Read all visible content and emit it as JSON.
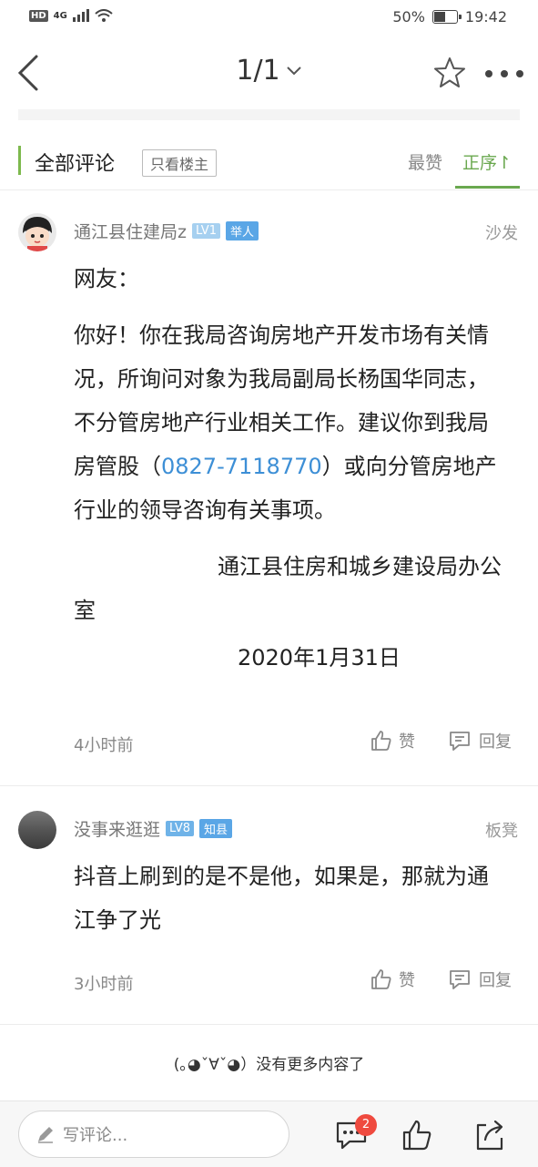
{
  "status_bar": {
    "hd": "HD",
    "network": "4G",
    "battery": "50%",
    "time": "19:42"
  },
  "nav": {
    "page_indicator": "1/1",
    "icons": [
      "back-icon",
      "chevron-down-icon",
      "star-icon",
      "more-icon"
    ]
  },
  "tabs": {
    "title": "全部评论",
    "only_op": "只看楼主",
    "sort_hot": "最赞",
    "sort_asc": "正序↾"
  },
  "comments": [
    {
      "user": "通江县住建局z",
      "level": "LV1",
      "badge": "举人",
      "floor": "沙发",
      "greeting": "网友：",
      "body_prefix": "你好！你在我局咨询房地产开发市场有关情况，所询问对象为我局副局长杨国华同志，不分管房地产行业相关工作。建议你到我局房管股（",
      "phone": "0827-7118770",
      "body_suffix": "）或向分管房地产行业的领导咨询有关事项。",
      "signature": "通江县住房和城乡建设局办公室",
      "date": "2020年1月31日",
      "time": "4小时前",
      "like": "赞",
      "reply": "回复"
    },
    {
      "user": "没事来逛逛",
      "level": "LV8",
      "badge": "知县",
      "floor": "板凳",
      "body": "抖音上刷到的是不是他，如果是，那就为通江争了光",
      "time": "3小时前",
      "like": "赞",
      "reply": "回复"
    }
  ],
  "end_text": "(｡◕ˇ∀ˇ◕）没有更多内容了",
  "bottom": {
    "placeholder": "写评论...",
    "comment_count": "2"
  },
  "colors": {
    "accent_green": "#6aa84f",
    "phone_blue": "#3d8fd6",
    "badge_blue": "#5aa6e6",
    "notify_red": "#ef4a3f"
  }
}
